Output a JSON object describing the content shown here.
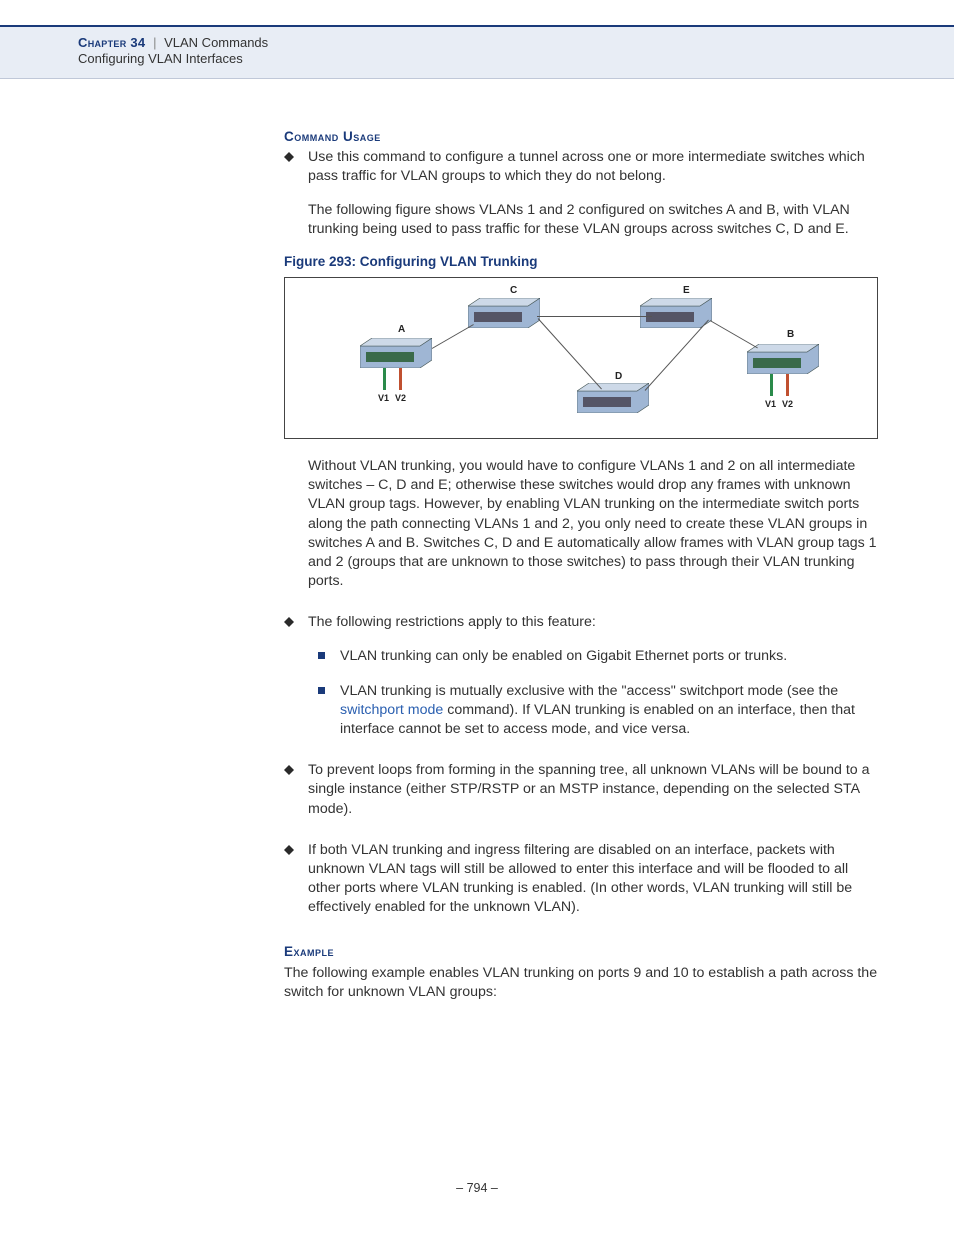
{
  "header": {
    "chapter_label": "Chapter 34",
    "separator": "|",
    "title": "VLAN Commands",
    "subtitle": "Configuring VLAN Interfaces"
  },
  "section_command_usage": "Command Usage",
  "bullet1_para1": "Use this command to configure a tunnel across one or more intermediate switches which pass traffic for VLAN groups to which they do not belong.",
  "bullet1_para2": "The following figure shows VLANs 1 and 2 configured on switches A and B, with VLAN trunking being used to pass traffic for these VLAN groups across switches C, D and E.",
  "figure_caption": "Figure 293:  Configuring VLAN Trunking",
  "figure_labels": {
    "A": "A",
    "B": "B",
    "C": "C",
    "D": "D",
    "E": "E",
    "V1": "V1",
    "V2": "V2"
  },
  "bullet1_para3": "Without VLAN trunking, you would have to configure VLANs 1 and 2 on all intermediate switches – C, D and E; otherwise these switches would drop any frames with unknown VLAN group tags. However, by enabling VLAN trunking on the intermediate switch ports along the path connecting VLANs 1 and 2, you only need to create these VLAN groups in switches A and B. Switches C, D and E automatically allow frames with VLAN group tags 1 and 2 (groups that are unknown to those switches) to pass through their VLAN trunking ports.",
  "bullet2_intro": "The following restrictions apply to this feature:",
  "sub1": "VLAN trunking can only be enabled on Gigabit Ethernet ports or trunks.",
  "sub2_pre": "VLAN trunking is mutually exclusive with the \"access\" switchport mode (see the ",
  "sub2_link": "switchport mode",
  "sub2_post": " command). If VLAN trunking is enabled on an interface, then that interface cannot be set to access mode, and vice versa.",
  "bullet3": "To prevent loops from forming in the spanning tree, all unknown VLANs will be bound to a single instance (either STP/RSTP or an MSTP instance, depending on the selected STA mode).",
  "bullet4": "If both VLAN trunking and ingress filtering are disabled on an interface, packets with unknown VLAN tags will still be allowed to enter this interface and will be flooded to all other ports where VLAN trunking is enabled. (In other words, VLAN trunking will still be effectively enabled for the unknown VLAN).",
  "section_example": "Example",
  "example_text": "The following example enables VLAN trunking on ports 9 and 10 to establish a path across the switch for unknown VLAN groups:",
  "footer": "–  794  –"
}
